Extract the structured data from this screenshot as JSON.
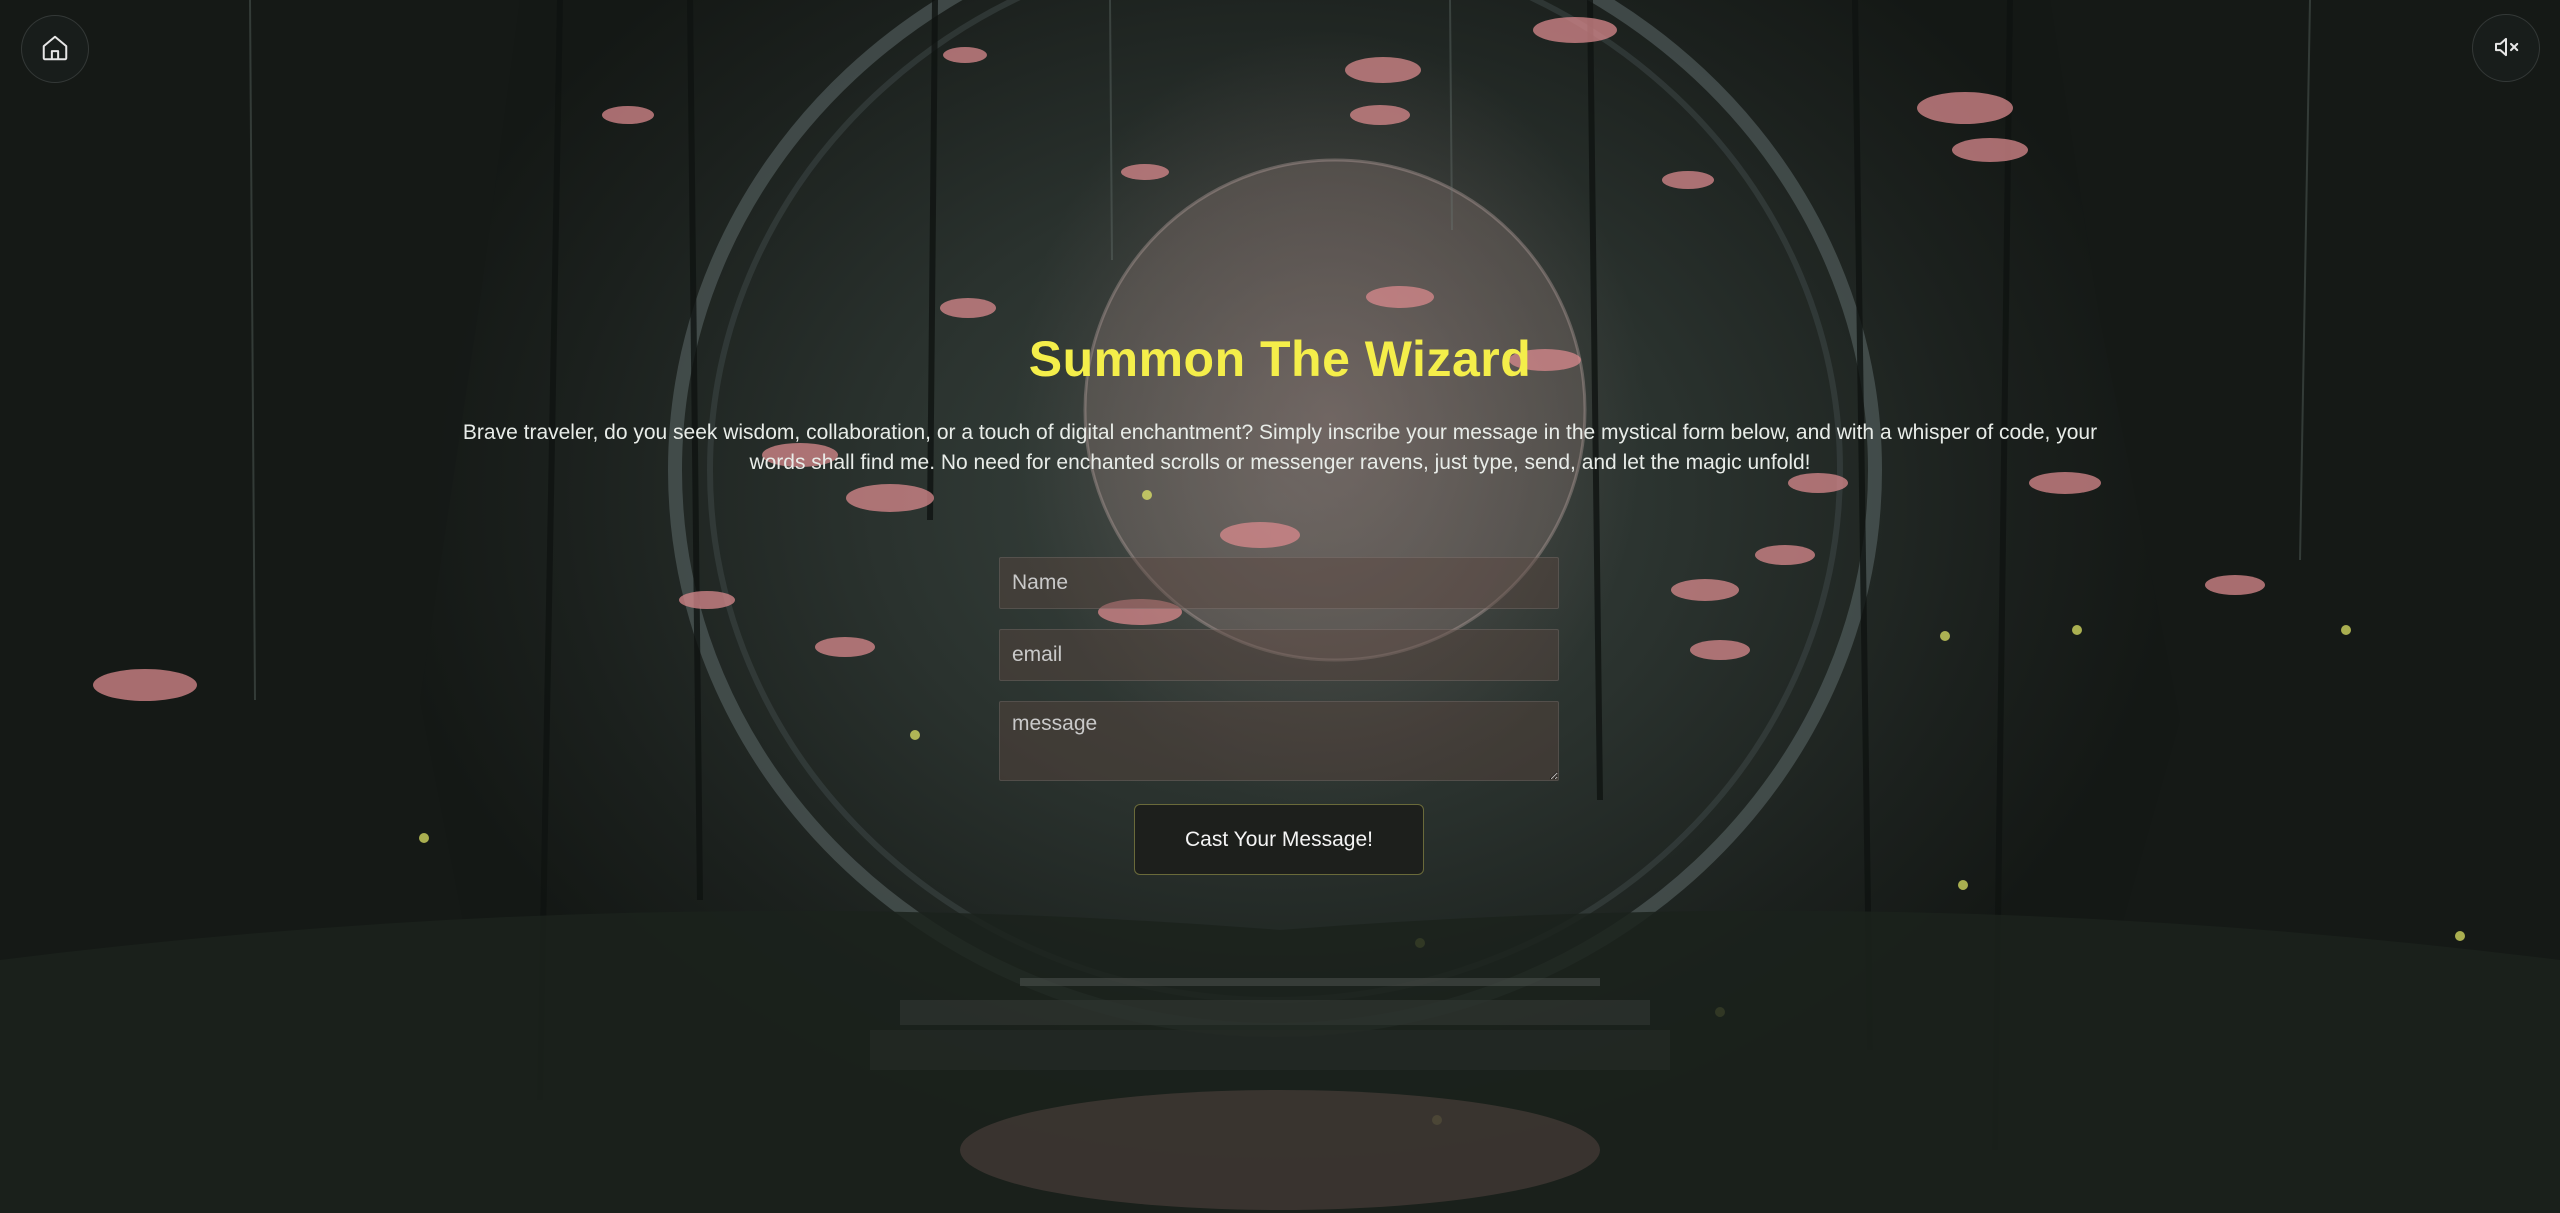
{
  "nav": {
    "home_icon": "home-icon",
    "mute_icon": "speaker-muted-icon"
  },
  "hero": {
    "title": "Summon The Wizard",
    "intro": "Brave traveler, do you seek wisdom, collaboration, or a touch of digital enchantment? Simply inscribe your message in the mystical form below, and with a whisper of code, your words shall find me. No need for enchanted scrolls or messenger ravens, just type, send, and let the magic unfold!"
  },
  "form": {
    "name_placeholder": "Name",
    "name_value": "",
    "email_placeholder": "email",
    "email_value": "",
    "message_placeholder": "message",
    "message_value": "",
    "submit_label": "Cast Your Message!"
  },
  "colors": {
    "title": "#f4ee4a",
    "button_border": "#6a6a3a",
    "background": "#1a1f1c"
  }
}
